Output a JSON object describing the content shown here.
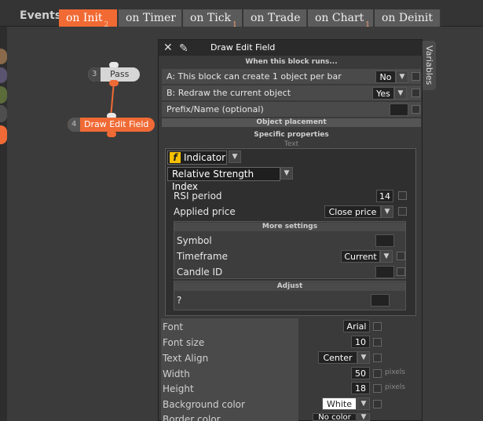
{
  "tabs": {
    "events_label": "Events",
    "items": [
      {
        "label": "on Init",
        "badge": "2",
        "active": true
      },
      {
        "label": "on Timer",
        "badge": ""
      },
      {
        "label": "on Tick",
        "badge": "1"
      },
      {
        "label": "on Trade",
        "badge": ""
      },
      {
        "label": "on Chart",
        "badge": "1"
      },
      {
        "label": "on Deinit",
        "badge": ""
      }
    ]
  },
  "canvas": {
    "pass_node": {
      "num": "3",
      "label": "Pass"
    },
    "draw_node": {
      "num": "4",
      "label": "Draw Edit Field"
    }
  },
  "panel": {
    "title": "Draw Edit Field",
    "variables_tab": "Variables",
    "when_runs": "When this block runs...",
    "rows": {
      "create_label": "A: This block can create 1 object per bar",
      "create_value": "No",
      "redraw_label": "B: Redraw the current object",
      "redraw_value": "Yes",
      "prefix_label": "Prefix/Name (optional)"
    },
    "object_placement": "Object placement",
    "specific_properties": "Specific properties",
    "text_label": "Text",
    "indicator_btn": "Indicator",
    "indicator_icon": "f",
    "indicator_select": "Relative Strength Index",
    "rsi_period_label": "RSI period",
    "rsi_period_value": "14",
    "applied_price_label": "Applied price",
    "applied_price_value": "Close price",
    "more_settings": "More settings",
    "symbol_label": "Symbol",
    "timeframe_label": "Timeframe",
    "timeframe_value": "Current",
    "candle_label": "Candle ID",
    "adjust": "Adjust",
    "adjust_label": "?",
    "font_label": "Font",
    "font_value": "Arial",
    "font_size_label": "Font size",
    "font_size_value": "10",
    "text_align_label": "Text Align",
    "text_align_value": "Center",
    "width_label": "Width",
    "width_value": "50",
    "height_label": "Height",
    "height_value": "18",
    "pixels": "pixels",
    "bg_label": "Background color",
    "bg_value": "White",
    "border_label": "Border color",
    "border_value": "No color"
  },
  "colors": {
    "accent": "#f16a33",
    "panel": "#3a3a3a"
  }
}
